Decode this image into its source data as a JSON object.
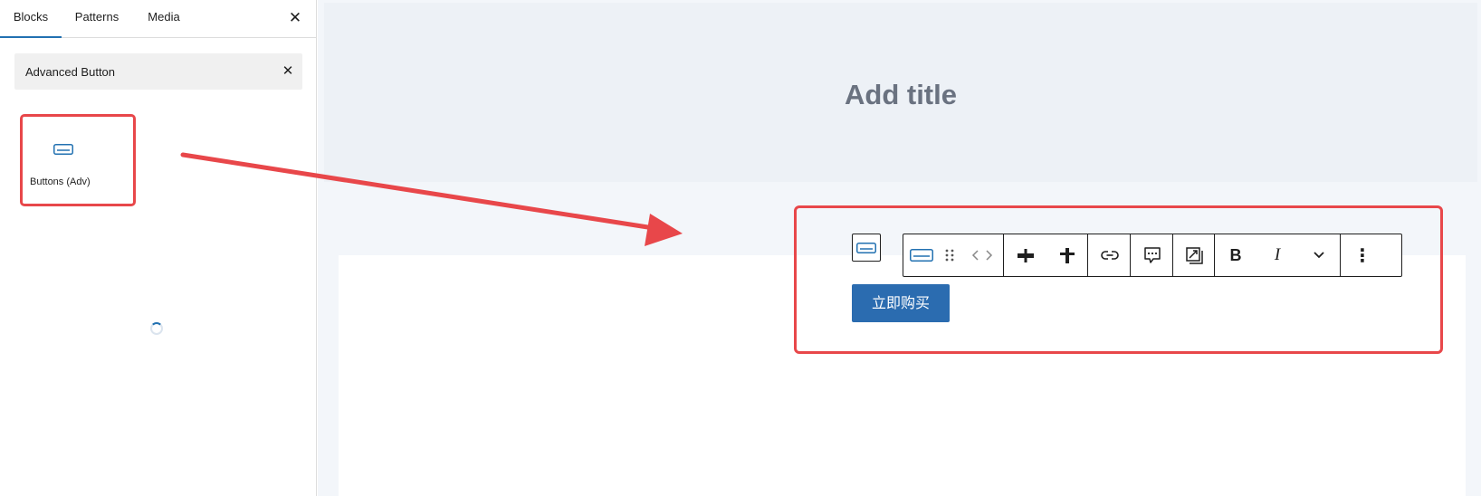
{
  "inserter": {
    "tabs": [
      {
        "label": "Blocks",
        "active": true
      },
      {
        "label": "Patterns",
        "active": false
      },
      {
        "label": "Media",
        "active": false
      }
    ],
    "close_icon": "close-icon",
    "search": {
      "value": "Advanced Button",
      "clear_icon": "close-icon"
    },
    "results": [
      {
        "label": "Buttons (Adv)",
        "icon": "button-block-icon"
      }
    ],
    "loading": true
  },
  "editor": {
    "title_placeholder": "Add title",
    "block_toolbar": {
      "buttons": [
        {
          "icon": "button-block-icon"
        },
        {
          "icon": "drag-handle-icon"
        },
        {
          "icon": "move-arrows-icon"
        },
        {
          "icon": "justify-center-icon"
        },
        {
          "icon": "align-vertical-icon"
        },
        {
          "icon": "link-icon"
        },
        {
          "icon": "tooltip-comment-icon"
        },
        {
          "icon": "resize-icon"
        },
        {
          "icon": "bold-icon",
          "label": "B"
        },
        {
          "icon": "italic-icon",
          "label": "I"
        },
        {
          "icon": "chevron-down-icon"
        },
        {
          "icon": "more-options-icon",
          "label": "⋮"
        }
      ]
    },
    "button_block": {
      "text": "立即购买",
      "background_color": "#2b6cb0"
    }
  },
  "colors": {
    "accent": "#2271b1",
    "annotation": "#e8474a"
  }
}
